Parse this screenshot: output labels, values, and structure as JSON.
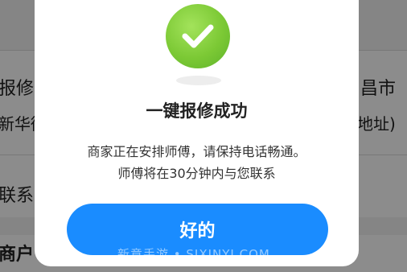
{
  "background": {
    "row1_left": "报修类",
    "row1_right": "昌市",
    "row2_left": "新华街",
    "row2_right": "地址)",
    "row3_left": "联系",
    "row4_left": "商户"
  },
  "modal": {
    "icon": "check-icon",
    "title": "一键报修成功",
    "desc_line1": "商家正在安排师傅，请保持电话畅通。",
    "desc_line2": "师傅将在30分钟内与您联系",
    "ok_label": "好的"
  },
  "watermark": "新意手游 • SJXINYI.COM",
  "colors": {
    "accent": "#1a8cff",
    "success": "#7cc935",
    "overlay": "rgba(0,0,0,0.45)"
  }
}
